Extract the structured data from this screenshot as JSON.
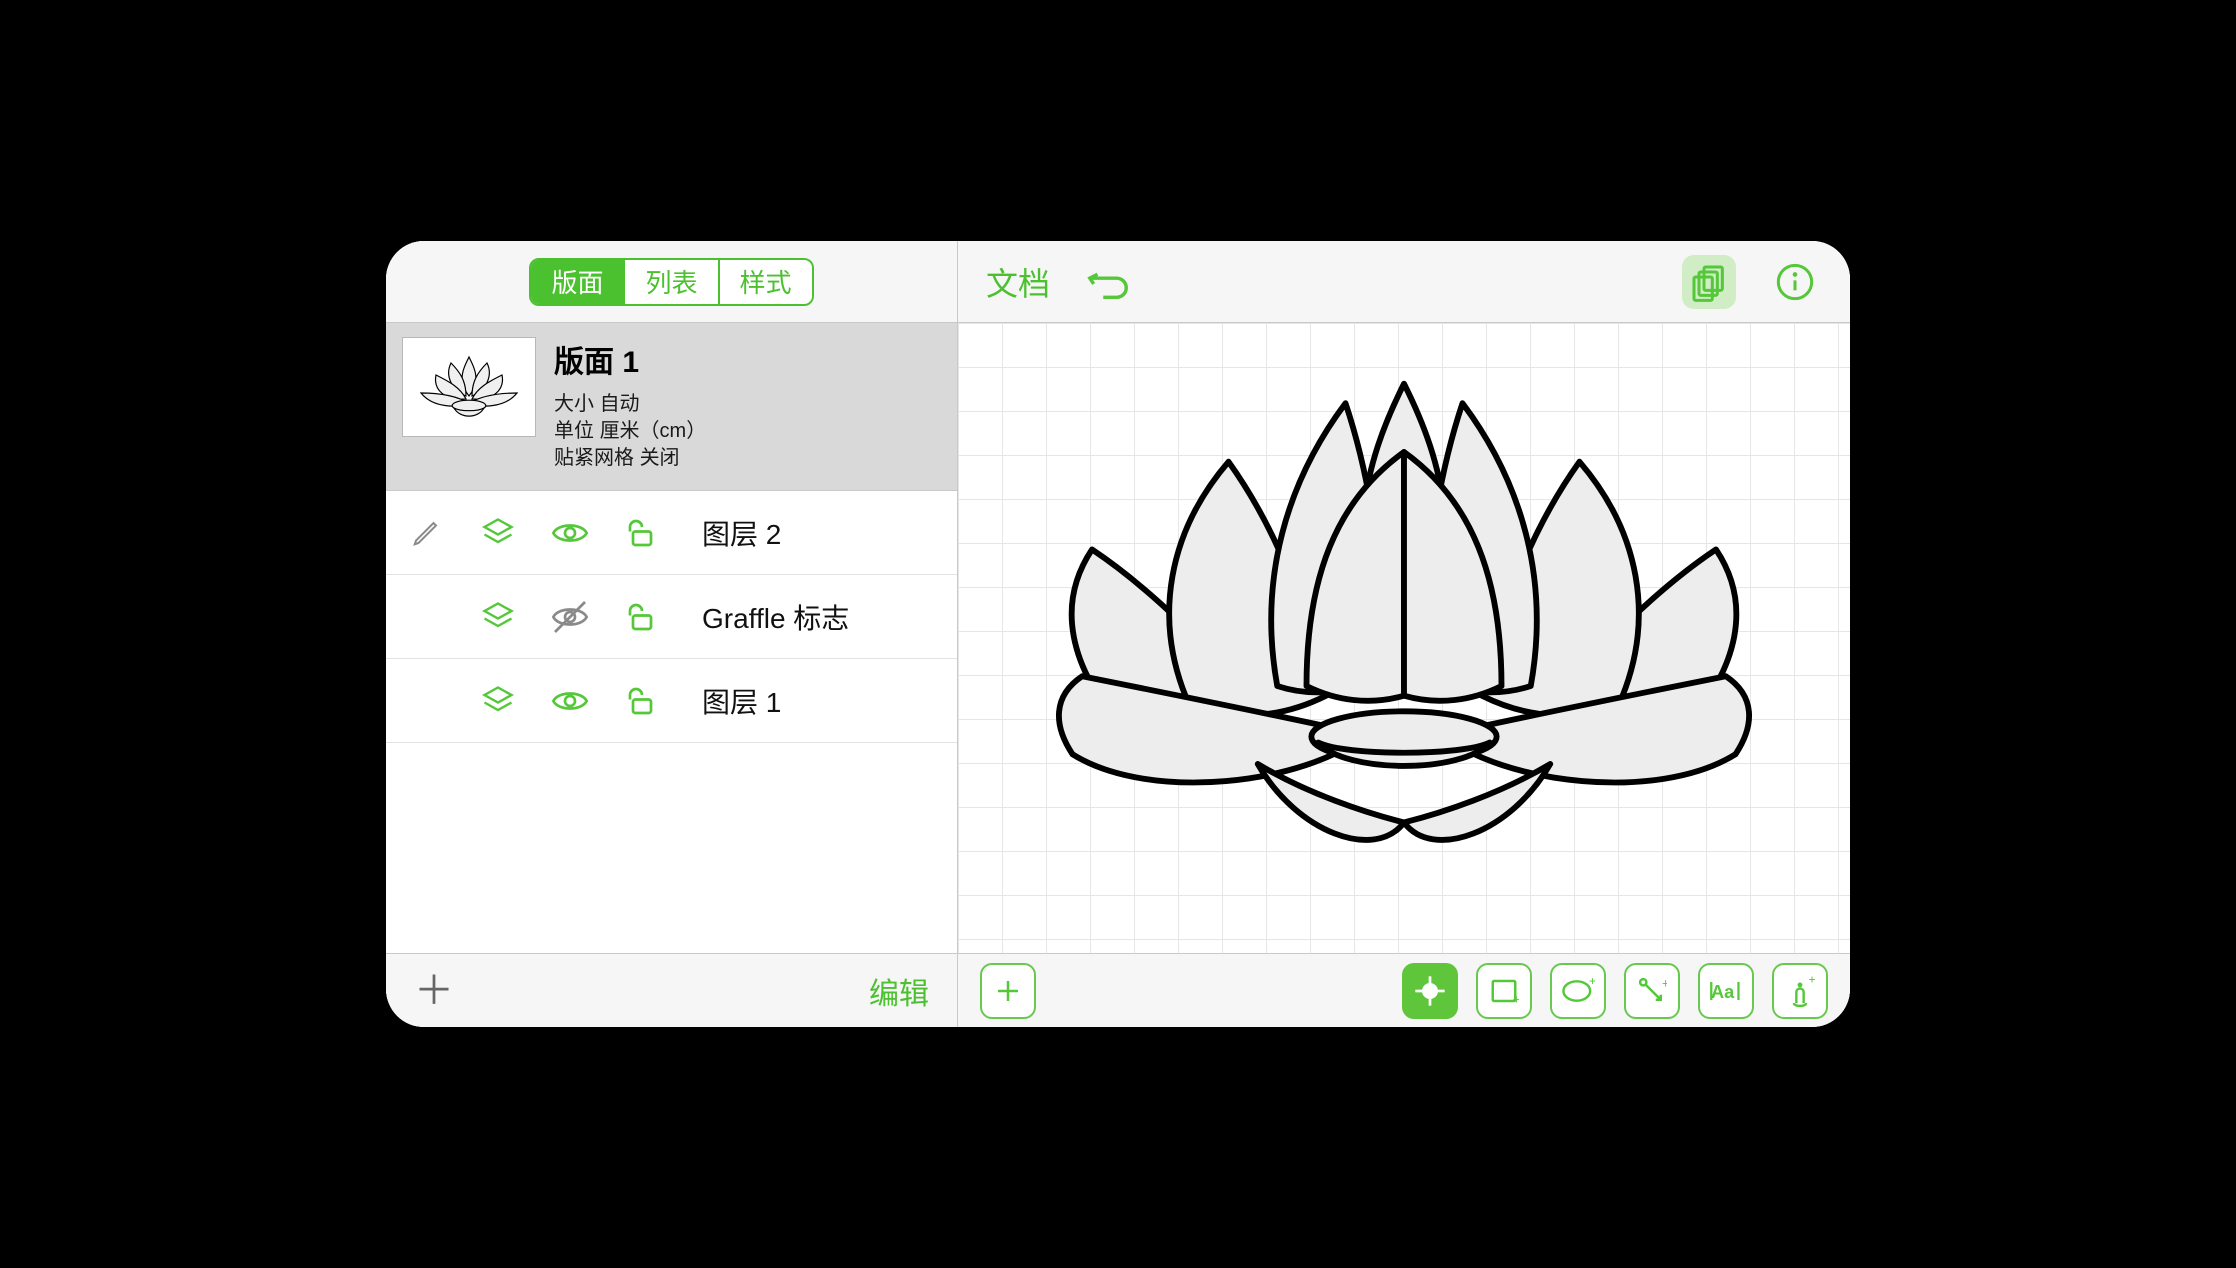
{
  "colors": {
    "accent": "#4cc12f"
  },
  "left": {
    "tabs": [
      "版面",
      "列表",
      "样式"
    ],
    "active_tab_index": 0,
    "canvas": {
      "title": "版面 1",
      "size_label": "大小",
      "size_value": "自动",
      "units_label": "单位",
      "units_value": "厘米（cm）",
      "snap_label": "贴紧网格",
      "snap_value": "关闭"
    },
    "layers": [
      {
        "name": "图层 2",
        "editing": true,
        "visible": true,
        "locked": false
      },
      {
        "name": "Graffle 标志",
        "editing": false,
        "visible": false,
        "locked": false
      },
      {
        "name": "图层 1",
        "editing": false,
        "visible": true,
        "locked": false
      }
    ],
    "footer": {
      "edit": "编辑"
    }
  },
  "right": {
    "document_label": "文档",
    "tools": [
      "add",
      "target",
      "rect",
      "ellipse",
      "line",
      "text",
      "touch"
    ],
    "active_tool_index": 1,
    "copies_active": true
  }
}
